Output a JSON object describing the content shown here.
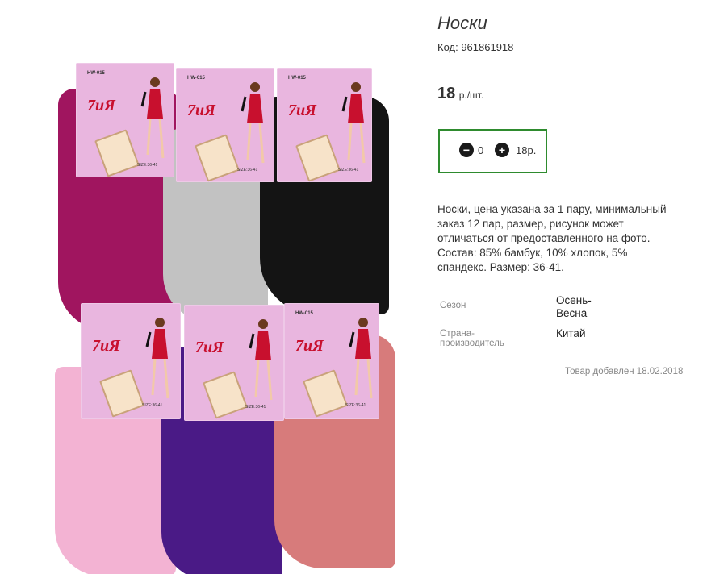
{
  "product": {
    "title": "Носки",
    "sku": "Код: 961861918",
    "price_value": "18",
    "price_unit": "р./шт.",
    "quantity": "0",
    "sum": "18р.",
    "description": "Носки, цена указана за 1 пару, минимальный заказ 12 пар, размер, рисунок может отличаться от предоставленного на фото. Состав: 85% бамбук, 10% хлопок, 5% спандекс. Размер: 36-41.",
    "properties": [
      {
        "key": "Сезон",
        "value": "Осень-Весна"
      },
      {
        "key": "Страна-производитель",
        "value": "Китай"
      }
    ],
    "added": "Товар добавлен 18.02.2018"
  },
  "packages": [
    {
      "code": "HW-015",
      "brand": "7иЯ",
      "size": "SIZE:36-41",
      "sock_color": "#a0155f"
    },
    {
      "code": "HW-015",
      "brand": "7иЯ",
      "size": "SIZE:36-41",
      "sock_color": "#c2c2c2"
    },
    {
      "code": "HW-015",
      "brand": "7иЯ",
      "size": "SIZE:36-41",
      "sock_color": "#141414"
    },
    {
      "code": "",
      "brand": "7иЯ",
      "size": "SIZE:36-41",
      "sock_color": "#f3b3d3"
    },
    {
      "code": "",
      "brand": "7иЯ",
      "size": "SIZE:36-41",
      "sock_color": "#4a1a86"
    },
    {
      "code": "HW-015",
      "brand": "7иЯ",
      "size": "SIZE:36-41",
      "sock_color": "#d77b7b"
    }
  ],
  "colors": {
    "accent_border": "#2e8b2e"
  }
}
